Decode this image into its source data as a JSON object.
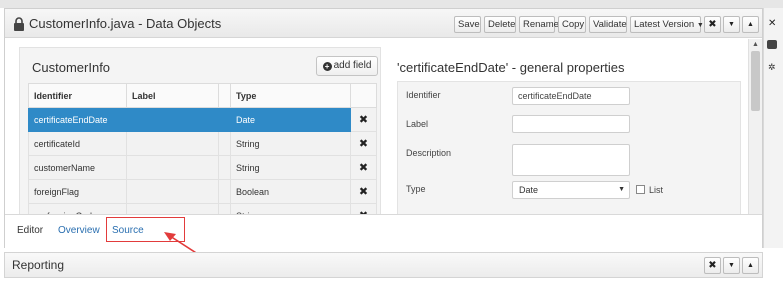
{
  "editor": {
    "title": "CustomerInfo.java - Data Objects",
    "toolbar": {
      "save": "Save",
      "delete": "Delete",
      "rename": "Rename",
      "copy": "Copy",
      "validate": "Validate",
      "latest_version": "Latest Version",
      "dropdown_caret": "▼",
      "close": "✖",
      "menu_caret": "▼",
      "collapse": "▲"
    }
  },
  "left_panel": {
    "heading": "CustomerInfo",
    "add_field": "add field",
    "add_icon": "+",
    "columns": [
      "Identifier",
      "Label",
      "",
      "Type",
      ""
    ],
    "rows": [
      {
        "identifier": "certificateEndDate",
        "label": "",
        "type": "Date",
        "delete": "✖",
        "selected": true
      },
      {
        "identifier": "certificateId",
        "label": "",
        "type": "String",
        "delete": "✖",
        "selected": false
      },
      {
        "identifier": "customerName",
        "label": "",
        "type": "String",
        "delete": "✖",
        "selected": false
      },
      {
        "identifier": "foreignFlag",
        "label": "",
        "type": "Boolean",
        "delete": "✖",
        "selected": false
      },
      {
        "identifier": "professionCode",
        "label": "",
        "type": "String",
        "delete": "✖",
        "selected": false
      }
    ]
  },
  "properties": {
    "heading": "'certificateEndDate' - general properties",
    "identifier_label": "Identifier",
    "identifier_value": "certificateEndDate",
    "label_label": "Label",
    "label_value": "",
    "description_label": "Description",
    "type_label": "Type",
    "type_value": "Date",
    "type_caret": "▼",
    "list_label": "List"
  },
  "scrollbar": {
    "up": "▲",
    "down": "▼"
  },
  "tabs": {
    "editor": "Editor",
    "overview": "Overview",
    "source": "Source"
  },
  "side_strip": {
    "close": "✕",
    "gear": "✲"
  },
  "reporting": {
    "title": "Reporting",
    "close": "✖",
    "menu_caret": "▼",
    "collapse": "▲"
  },
  "colors": {
    "selection_blue": "#2f8ac7",
    "link_blue": "#2a6fb0",
    "highlight_red": "#e23b3b"
  }
}
